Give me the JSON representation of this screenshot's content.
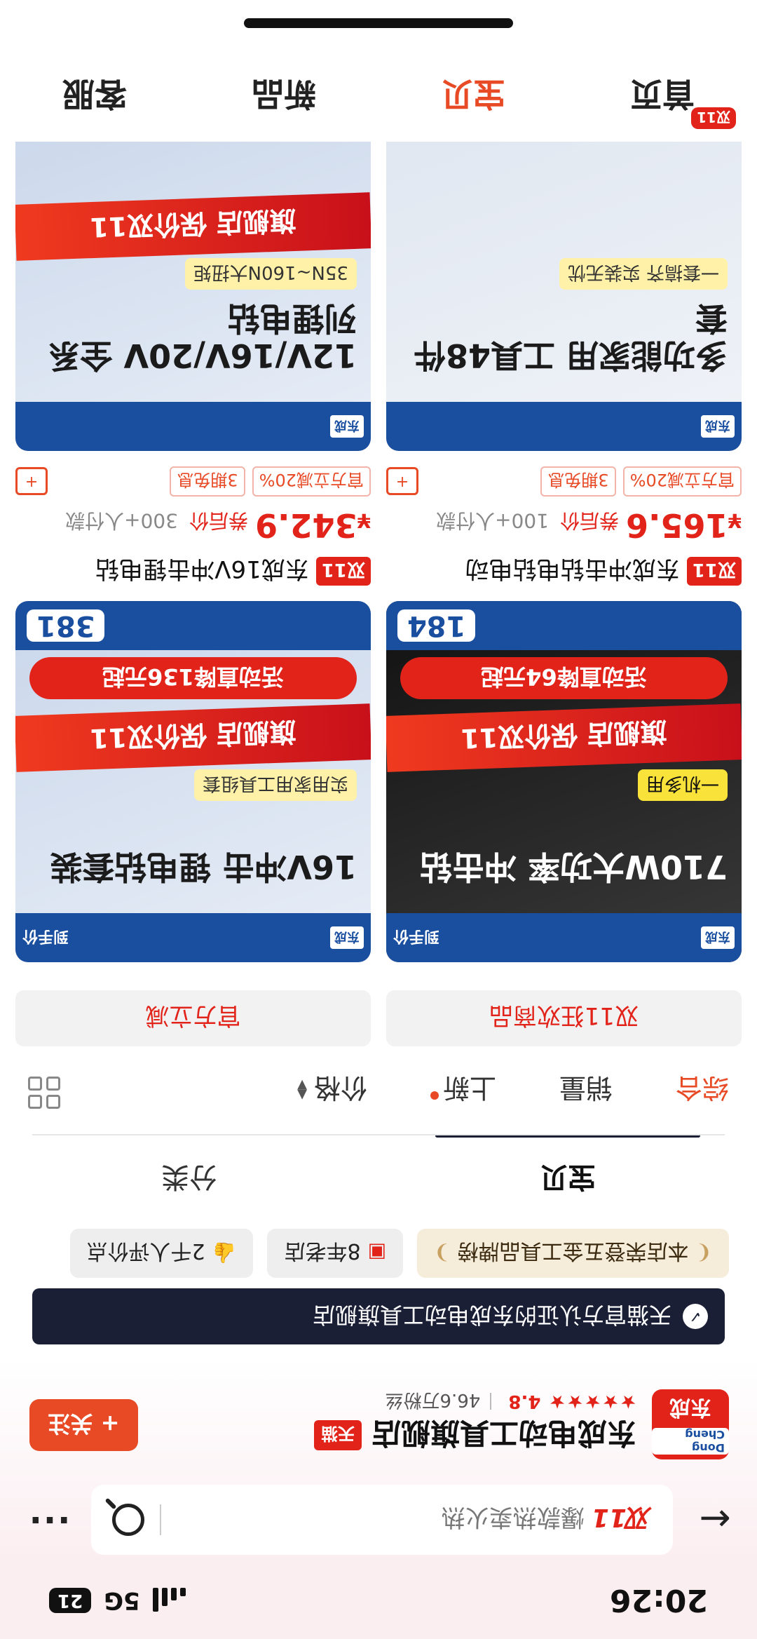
{
  "status": {
    "time": "20:26",
    "network": "5G",
    "battery": "21"
  },
  "search": {
    "badge": "双11",
    "placeholder": "爆款热卖火热"
  },
  "shop": {
    "name": "东成电动工具旗舰店",
    "platform_tag": "天猫",
    "rating": "4.8",
    "fans": "46.6万粉丝",
    "follow": "+ 关注",
    "logo_text": "东成",
    "logo_brand": "Dong Cheng"
  },
  "banner": {
    "text": "天猫官方认证的东成电动工具旗舰店"
  },
  "chips": [
    {
      "text": "本店荣登五金工具品牌榜"
    },
    {
      "text": "8年老店"
    },
    {
      "text": "2千人评价点"
    }
  ],
  "tabs": [
    {
      "label": "宝贝"
    },
    {
      "label": "分类"
    }
  ],
  "sort": [
    {
      "label": "综合"
    },
    {
      "label": "销量"
    },
    {
      "label": "上新"
    },
    {
      "label": "价格"
    }
  ],
  "categories": [
    {
      "label": "双11狂欢商品"
    },
    {
      "label": "官方立减"
    }
  ],
  "products": [
    {
      "title": "东成冲击钻电钻电动",
      "badge": "双11",
      "price": "165.6",
      "price_label": "券后价",
      "sold": "100+人付款",
      "tags": [
        "官方立减20%",
        "3期免息"
      ],
      "img_headline": "710W大功率 冲击钻",
      "img_sub": "一机多用",
      "img_flag": "旗舰店 保价双11",
      "img_drop": "活动直降64元起",
      "img_num": "184"
    },
    {
      "title": "东成16V冲击锂电钻",
      "badge": "双11",
      "price": "342.9",
      "price_label": "券后价",
      "sold": "300+人付款",
      "tags": [
        "官方立减20%",
        "3期免息"
      ],
      "img_headline": "16V冲击 锂电钻套装",
      "img_sub": "实用家用工具组套",
      "img_flag": "旗舰店 保价双11",
      "img_drop": "活动直降136元起",
      "img_num": "381"
    },
    {
      "title": "",
      "badge": "",
      "price": "",
      "price_label": "",
      "sold": "",
      "tags": [],
      "img_headline": "多功能家用 工具48件套",
      "img_sub": "一套搞齐 实装无忧",
      "img_flag": "",
      "img_drop": "",
      "img_num": ""
    },
    {
      "title": "",
      "badge": "",
      "price": "",
      "price_label": "",
      "sold": "",
      "tags": [],
      "img_headline": "12V/16V/20V 全系列锂电钻",
      "img_sub": "35N~160N大扭矩",
      "img_flag": "旗舰店 保价双11",
      "img_drop": "",
      "img_num": ""
    }
  ],
  "bottom_nav": [
    {
      "label": "首页",
      "badge": "双11"
    },
    {
      "label": "宝贝"
    },
    {
      "label": "新品"
    },
    {
      "label": "客服"
    }
  ],
  "colors": {
    "accent": "#e84a26",
    "brand_red": "#e2231a",
    "dark": "#1a1f36",
    "brand_blue": "#1a4fa0"
  }
}
